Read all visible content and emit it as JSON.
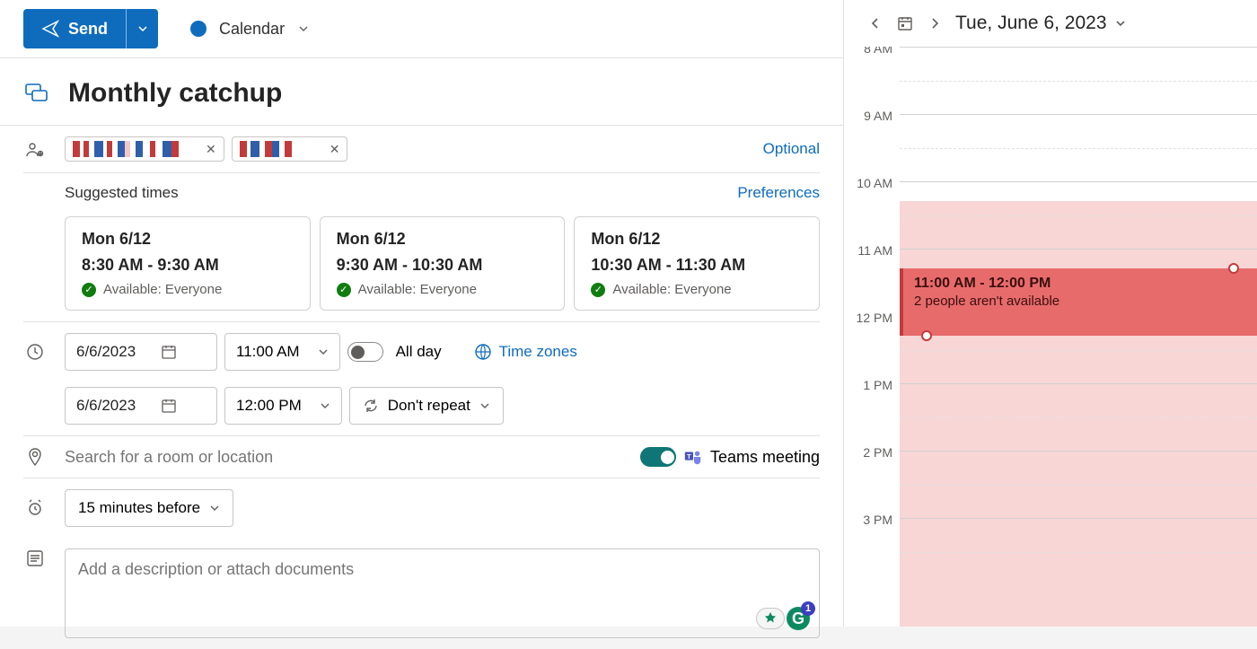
{
  "toolbar": {
    "send_label": "Send",
    "calendar_label": "Calendar"
  },
  "title": "Monthly catchup",
  "attendees": {
    "optional_link": "Optional"
  },
  "suggested": {
    "heading": "Suggested times",
    "preferences_link": "Preferences",
    "cards": [
      {
        "date": "Mon 6/12",
        "range": "8:30 AM - 9:30 AM",
        "avail": "Available: Everyone"
      },
      {
        "date": "Mon 6/12",
        "range": "9:30 AM - 10:30 AM",
        "avail": "Available: Everyone"
      },
      {
        "date": "Mon 6/12",
        "range": "10:30 AM - 11:30 AM",
        "avail": "Available: Everyone"
      }
    ]
  },
  "time": {
    "start_date": "6/6/2023",
    "start_time": "11:00 AM",
    "end_date": "6/6/2023",
    "end_time": "12:00 PM",
    "allday_label": "All day",
    "timezones_label": "Time zones",
    "repeat_label": "Don't repeat"
  },
  "location": {
    "placeholder": "Search for a room or location",
    "teams_label": "Teams meeting"
  },
  "reminder": {
    "label": "15 minutes before"
  },
  "description": {
    "placeholder": "Add a description or attach documents",
    "badge_count": "1"
  },
  "sidecal": {
    "date_label": "Tue, June 6, 2023",
    "hours": [
      "8 AM",
      "9 AM",
      "10 AM",
      "11 AM",
      "12 PM",
      "1 PM",
      "2 PM",
      "3 PM"
    ],
    "event": {
      "time_range": "11:00 AM - 12:00 PM",
      "status": "2 people aren't available"
    }
  }
}
